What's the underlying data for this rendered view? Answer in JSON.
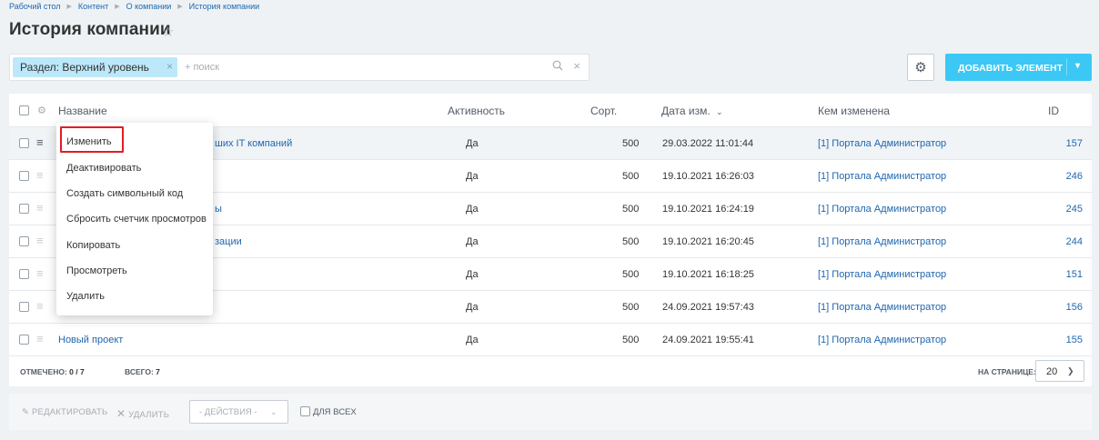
{
  "breadcrumb": [
    "Рабочий стол",
    "Контент",
    "О компании",
    "История компании"
  ],
  "page": {
    "title": "История компании"
  },
  "filter": {
    "tag_label": "Раздел: Верхний уровень",
    "placeholder": "+ поиск"
  },
  "toolbar": {
    "add_label": "ДОБАВИТЬ ЭЛЕМЕНТ"
  },
  "grid": {
    "columns": {
      "name": "Название",
      "active": "Активность",
      "sort": "Сорт.",
      "date": "Дата изм.",
      "editor": "Кем изменена",
      "id": "ID"
    },
    "rows": [
      {
        "name": "ших IT компаний",
        "active": "Да",
        "sort": "500",
        "date": "29.03.2022 11:01:44",
        "editor": "[1] Портала Администратор",
        "id": "157"
      },
      {
        "name": "",
        "active": "Да",
        "sort": "500",
        "date": "19.10.2021 16:26:03",
        "editor": "[1] Портала Администратор",
        "id": "246"
      },
      {
        "name": "ы",
        "active": "Да",
        "sort": "500",
        "date": "19.10.2021 16:24:19",
        "editor": "[1] Портала Администратор",
        "id": "245"
      },
      {
        "name": "зации",
        "active": "Да",
        "sort": "500",
        "date": "19.10.2021 16:20:45",
        "editor": "[1] Портала Администратор",
        "id": "244"
      },
      {
        "name": "",
        "active": "Да",
        "sort": "500",
        "date": "19.10.2021 16:18:25",
        "editor": "[1] Портала Администратор",
        "id": "151"
      },
      {
        "name": "",
        "active": "Да",
        "sort": "500",
        "date": "24.09.2021 19:57:43",
        "editor": "[1] Портала Администратор",
        "id": "156"
      },
      {
        "name": "Новый проект",
        "active": "Да",
        "sort": "500",
        "date": "24.09.2021 19:55:41",
        "editor": "[1] Портала Администратор",
        "id": "155"
      }
    ],
    "footer": {
      "selected_label": "ОТМЕЧЕНО:",
      "selected_value": "0 / 7",
      "total_label": "ВСЕГО:",
      "total_value": "7",
      "per_page_label": "НА СТРАНИЦЕ:",
      "per_page_value": "20"
    }
  },
  "actions": {
    "edit": "РЕДАКТИРОВАТЬ",
    "delete": "УДАЛИТЬ",
    "select": "- ДЕЙСТВИЯ -",
    "for_all": "ДЛЯ ВСЕХ"
  },
  "context_menu": {
    "items": [
      "Изменить",
      "Деактивировать",
      "Создать символьный код",
      "Сбросить счетчик просмотров",
      "Копировать",
      "Просмотреть",
      "Удалить"
    ]
  },
  "colors": {
    "accent": "#3bc8f5",
    "link": "#2067b0",
    "highlight_border": "#e21c25",
    "tag_bg": "#bce8f9"
  }
}
